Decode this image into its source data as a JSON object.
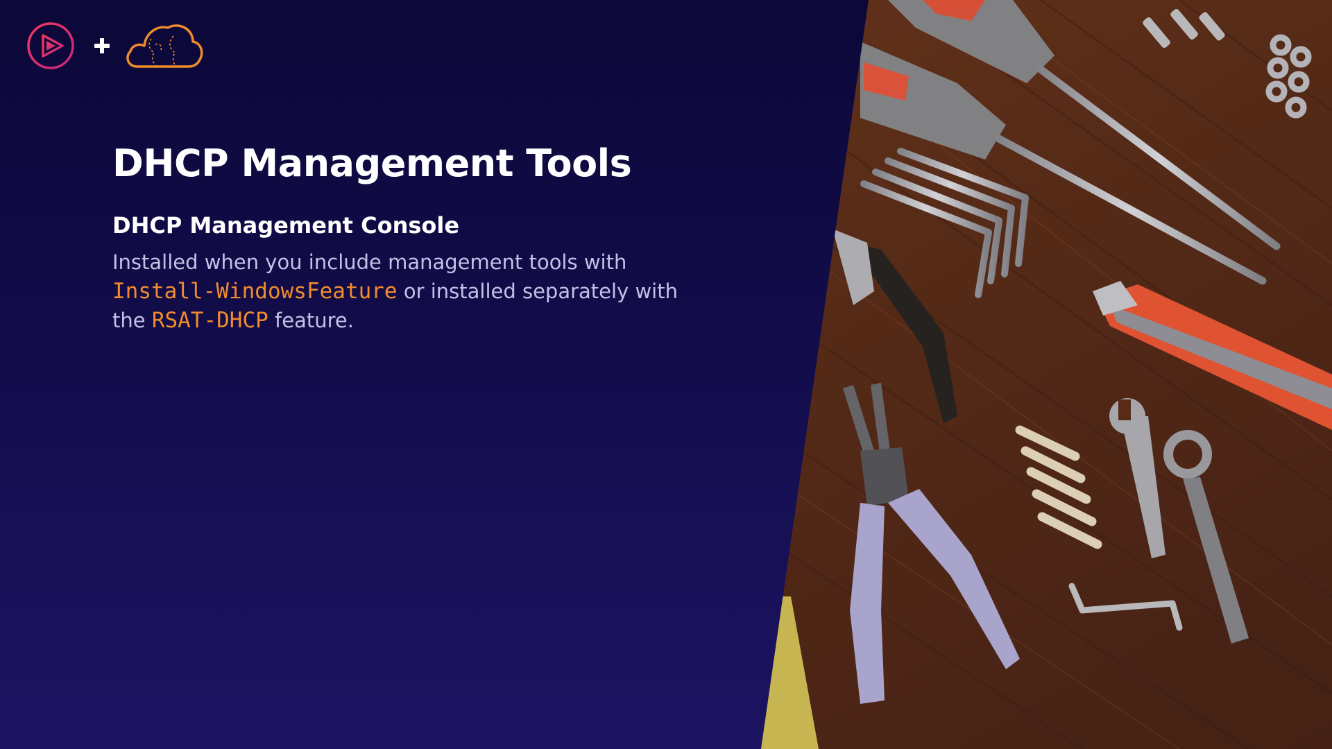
{
  "slide": {
    "title": "DHCP Management Tools",
    "subtitle": "DHCP Management Console",
    "body": {
      "text1": "Installed when you include management tools with ",
      "code1": "Install-WindowsFeature",
      "text2": " or installed separately with the ",
      "code2": "RSAT-DHCP",
      "text3": " feature."
    }
  },
  "logos": {
    "left_icon": "play-circle-logo-icon",
    "separator_icon": "plus-icon",
    "right_icon": "cloud-logo-icon"
  },
  "photo": {
    "subject": "tools-on-wooden-table-photo"
  },
  "colors": {
    "background": "#120c4a",
    "accent_code": "#f08c2c",
    "title": "#ffffff",
    "body_text": "#c5c1e6",
    "logo_pink": "#e8356d",
    "logo_orange": "#f08c2c"
  }
}
